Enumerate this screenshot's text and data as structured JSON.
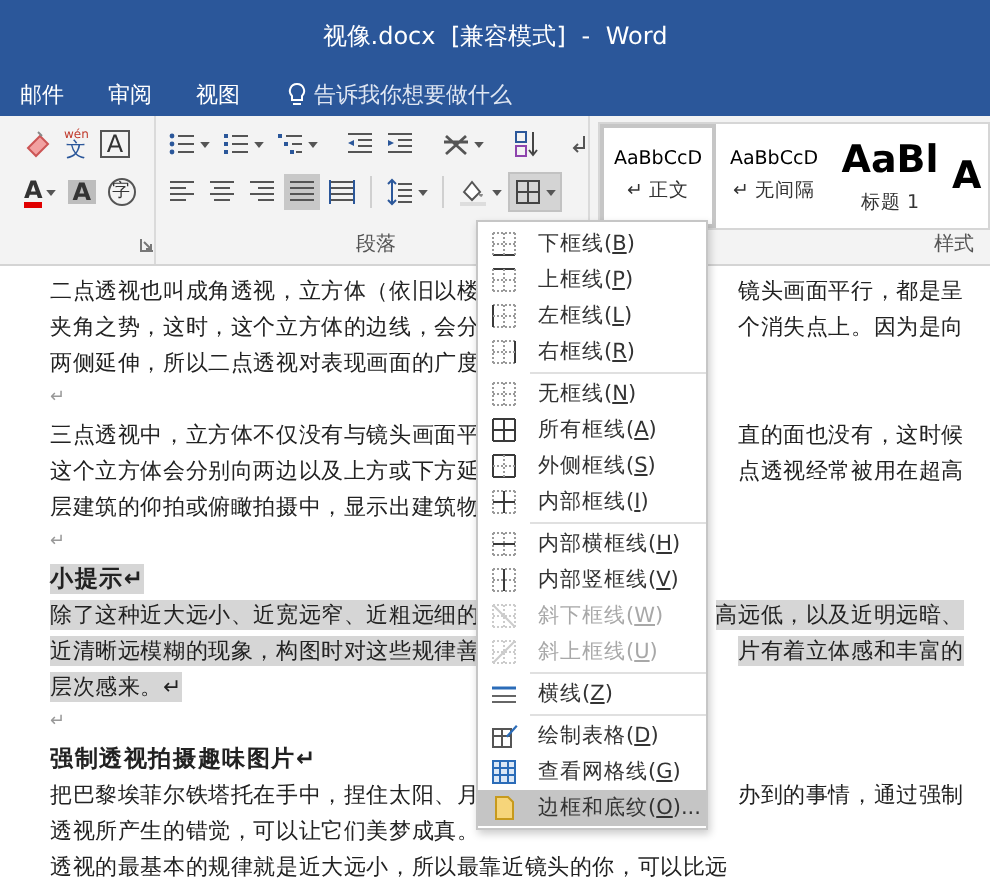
{
  "window": {
    "title": "视像.docx [兼容模式] - Word"
  },
  "tabs": [
    {
      "label": "邮件"
    },
    {
      "label": "审阅"
    },
    {
      "label": "视图"
    }
  ],
  "tell_me": {
    "placeholder": "告诉我你想要做什么"
  },
  "ribbon": {
    "font_tools": [
      {
        "kind": "eraser"
      },
      {
        "kind": "phonetic",
        "ruby": "wén",
        "text": "文"
      },
      {
        "kind": "boxed",
        "text": "A"
      }
    ],
    "font_tools_2": [
      {
        "kind": "font_color",
        "text": "A"
      },
      {
        "kind": "shaded",
        "text": "A"
      },
      {
        "kind": "enclosed",
        "text": "字"
      }
    ],
    "alignment": [
      {
        "selected": false
      },
      {
        "selected": false
      },
      {
        "selected": false
      },
      {
        "selected": true
      },
      {
        "selected": false
      }
    ],
    "borders_button": {
      "expanded": true
    },
    "groups": [
      {
        "label": "段落"
      },
      {
        "label": "样式"
      }
    ],
    "styles": [
      {
        "kind": "normal",
        "preview": "AaBbCcD",
        "name": "↵ 正文",
        "selected": true
      },
      {
        "kind": "normal",
        "preview": "AaBbCcD",
        "name": "↵ 无间隔",
        "selected": false
      },
      {
        "kind": "heading",
        "preview": "AaBl",
        "name": "标题 1",
        "selected": false
      },
      {
        "kind": "heading",
        "preview": "A",
        "selected": false
      }
    ]
  },
  "document": {
    "lines": [
      {
        "kind": "body",
        "left": "二点透视也叫成角透视，立方体（依旧以楼",
        "right": "镜头画面平行，都是呈",
        "highlighted": false
      },
      {
        "kind": "body",
        "left": "夹角之势，这时，这个立方体的边线，会分",
        "right": "个消失点上。因为是向",
        "highlighted": false
      },
      {
        "kind": "body",
        "left": "两侧延伸，所以二点透视对表现画面的广度",
        "highlighted": false
      },
      {
        "kind": "empty",
        "left": "↵",
        "highlighted": false
      },
      {
        "kind": "body",
        "left": "三点透视中，立方体不仅没有与镜头画面平",
        "right": "直的面也没有，这时候",
        "highlighted": false
      },
      {
        "kind": "body",
        "left": "这个立方体会分别向两边以及上方或下方延",
        "right": "点透视经常被用在超高",
        "highlighted": false
      },
      {
        "kind": "body",
        "left": "层建筑的仰拍或俯瞰拍摄中，显示出建筑物",
        "highlighted": false
      },
      {
        "kind": "empty",
        "left": "↵",
        "highlighted": false
      },
      {
        "kind": "heading",
        "left": "小提示↵",
        "highlighted": true
      },
      {
        "kind": "body",
        "left": "除了这种近大远小、近宽远窄、近粗远细的",
        "right": "高远低，以及近明远暗、",
        "highlighted": true
      },
      {
        "kind": "body",
        "left": "近清晰远模糊的现象，构图时对这些规律善",
        "right": "片有着立体感和丰富的",
        "highlighted": true
      },
      {
        "kind": "body",
        "left": "层次感来。↵",
        "highlighted": true
      },
      {
        "kind": "empty",
        "left": "↵",
        "highlighted": false
      },
      {
        "kind": "heading",
        "left": "强制透视拍摄趣味图片↵",
        "highlighted": false
      },
      {
        "kind": "body",
        "left": "把巴黎埃菲尔铁塔托在手中，捏住太阳、月",
        "right": "办到的事情，通过强制",
        "highlighted": false
      },
      {
        "kind": "body",
        "left": "透视所产生的错觉，可以让它们美梦成真。",
        "highlighted": false
      },
      {
        "kind": "body",
        "left": "透视的最基本的规律就是近大远小，所以最靠近镜头的你，可以比远",
        "highlighted": false
      }
    ]
  },
  "borders_menu": [
    {
      "kind": "item",
      "label": "下框线(B)",
      "disabled": false,
      "selected": false
    },
    {
      "kind": "item",
      "label": "上框线(P)",
      "disabled": false,
      "selected": false
    },
    {
      "kind": "item",
      "label": "左框线(L)",
      "disabled": false,
      "selected": false
    },
    {
      "kind": "item",
      "label": "右框线(R)",
      "disabled": false,
      "selected": false
    },
    {
      "kind": "separator"
    },
    {
      "kind": "item",
      "label": "无框线(N)",
      "disabled": false,
      "selected": false
    },
    {
      "kind": "item",
      "label": "所有框线(A)",
      "disabled": false,
      "selected": false
    },
    {
      "kind": "item",
      "label": "外侧框线(S)",
      "disabled": false,
      "selected": false
    },
    {
      "kind": "item",
      "label": "内部框线(I)",
      "disabled": false,
      "selected": false
    },
    {
      "kind": "separator"
    },
    {
      "kind": "item",
      "label": "内部横框线(H)",
      "disabled": false,
      "selected": false
    },
    {
      "kind": "item",
      "label": "内部竖框线(V)",
      "disabled": false,
      "selected": false
    },
    {
      "kind": "item",
      "label": "斜下框线(W)",
      "disabled": true,
      "selected": false
    },
    {
      "kind": "item",
      "label": "斜上框线(U)",
      "disabled": true,
      "selected": false
    },
    {
      "kind": "separator"
    },
    {
      "kind": "item",
      "label": "横线(Z)",
      "disabled": false,
      "selected": false
    },
    {
      "kind": "separator"
    },
    {
      "kind": "item",
      "label": "绘制表格(D)",
      "disabled": false,
      "selected": false
    },
    {
      "kind": "item",
      "label": "查看网格线(G)",
      "disabled": false,
      "selected": false
    },
    {
      "kind": "item",
      "label": "边框和底纹(O)...",
      "disabled": false,
      "selected": true
    }
  ]
}
